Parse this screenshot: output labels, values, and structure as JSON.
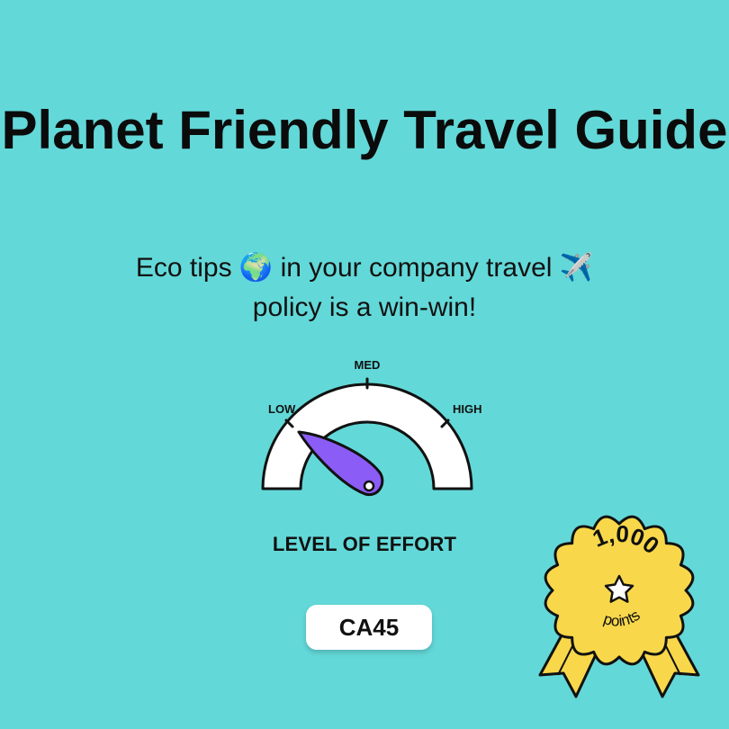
{
  "title": "Planet Friendly Travel Guide",
  "subtitle": {
    "part1": "Eco tips ",
    "globe": "🌍",
    "part2": " in your company travel ",
    "airplane": "✈️",
    "part3": "policy is a win-win!"
  },
  "gauge": {
    "labels": {
      "low": "LOW",
      "med": "MED",
      "high": "HIGH"
    },
    "caption": "LEVEL OF EFFORT",
    "level": "low",
    "needle_color": "#8b5cf6",
    "arc_color": "#ffffff"
  },
  "code": "CA45",
  "badge": {
    "points": "1,000",
    "unit": "points",
    "icon": "star-icon",
    "rosette_color": "#f8d84a",
    "ribbon_color": "#f8d84a"
  },
  "colors": {
    "background": "#63d8d8",
    "text": "#111111"
  }
}
